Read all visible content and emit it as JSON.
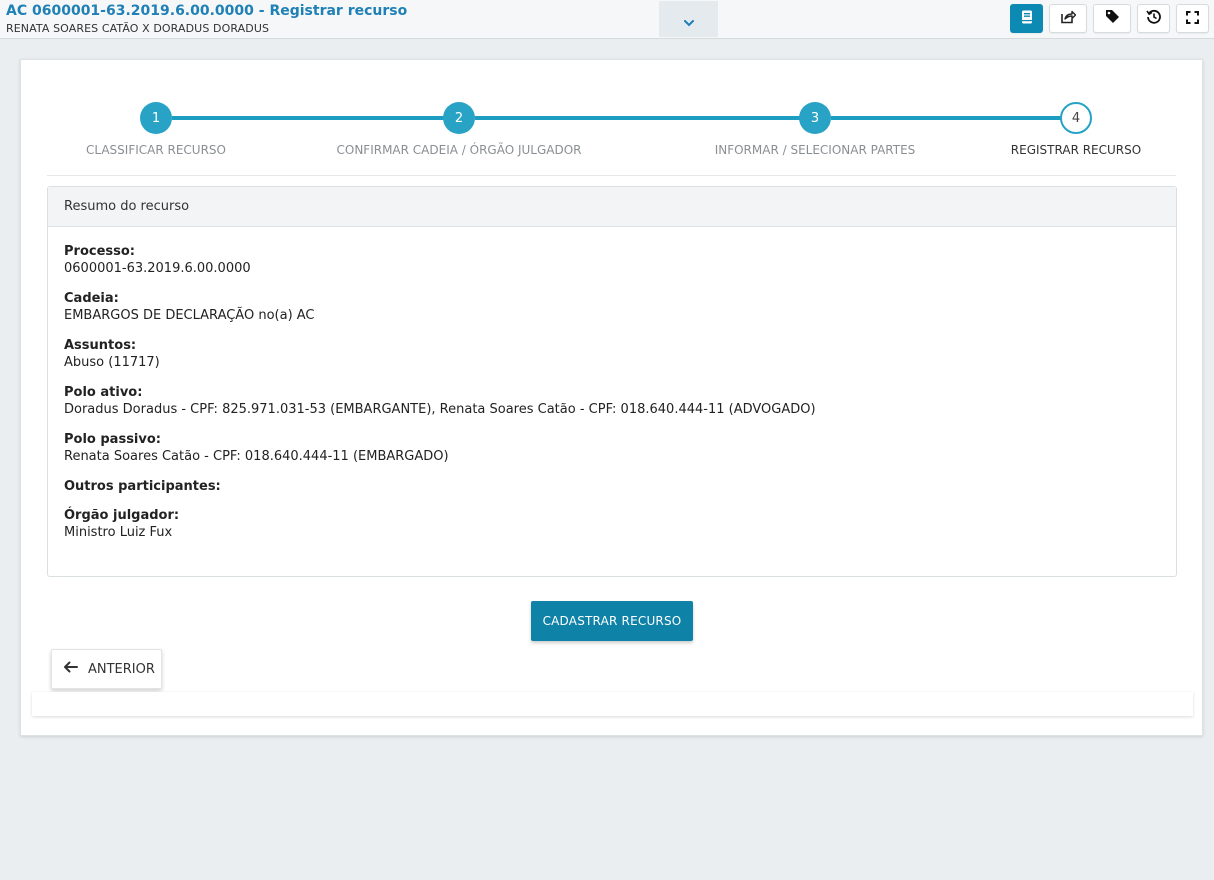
{
  "header": {
    "title": "AC 0600001-63.2019.6.00.0000 - Registrar recurso",
    "subtitle": "RENATA SOARES CATÃO X DORADUS DORADUS"
  },
  "toolbar": {
    "icons": [
      "book-icon",
      "share-icon",
      "tag-icon",
      "history-icon",
      "fullscreen-icon"
    ],
    "accent": "#0d8ab3"
  },
  "stepper": {
    "steps": [
      {
        "number": "1",
        "label": "CLASSIFICAR RECURSO",
        "state": "done"
      },
      {
        "number": "2",
        "label": "CONFIRMAR CADEIA / ÓRGÃO JULGADOR",
        "state": "done"
      },
      {
        "number": "3",
        "label": "INFORMAR / SELECIONAR PARTES",
        "state": "done"
      },
      {
        "number": "4",
        "label": "REGISTRAR RECURSO",
        "state": "current"
      }
    ],
    "line_color": "#1b9ec2"
  },
  "summary": {
    "heading": "Resumo do recurso",
    "fields": [
      {
        "label": "Processo:",
        "value": "0600001-63.2019.6.00.0000"
      },
      {
        "label": "Cadeia:",
        "value": "EMBARGOS DE DECLARAÇÃO no(a) AC"
      },
      {
        "label": "Assuntos:",
        "value": "Abuso (11717)"
      },
      {
        "label": "Polo ativo:",
        "value": "Doradus Doradus - CPF: 825.971.031-53 (EMBARGANTE), Renata Soares Catão - CPF: 018.640.444-11 (ADVOGADO)"
      },
      {
        "label": "Polo passivo:",
        "value": "Renata Soares Catão - CPF: 018.640.444-11 (EMBARGADO)"
      },
      {
        "label": "Outros participantes:",
        "value": ""
      },
      {
        "label": "Órgão julgador:",
        "value": "Ministro Luiz Fux"
      }
    ]
  },
  "actions": {
    "submit_label": "CADASTRAR RECURSO",
    "previous_label": "ANTERIOR"
  }
}
